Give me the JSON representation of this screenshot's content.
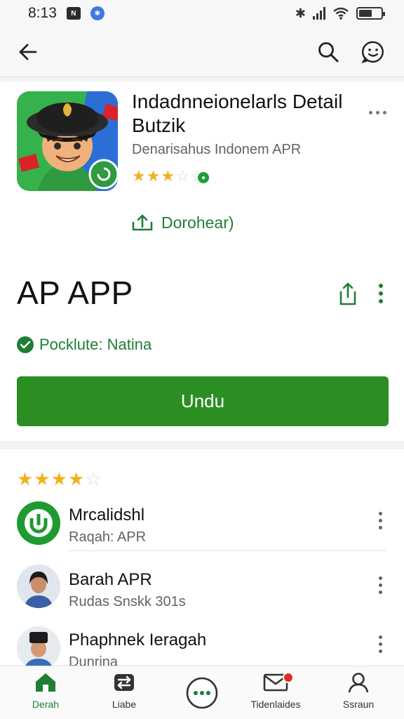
{
  "status_bar": {
    "time": "8:13",
    "badge_icon": "app-badge-icon",
    "notification_icon": "notification-dot-icon"
  },
  "top_bar": {
    "back_icon": "arrow-left-icon",
    "search_icon": "search-icon",
    "feedback_icon": "smiley-icon"
  },
  "app": {
    "title": "Indadnneionelarls Detail Butzik",
    "developer": "Denarisahus Indonem APR",
    "rating_stars": 3,
    "rating_max": 5,
    "download_label": "Dorohear)",
    "name": "AP APP",
    "verified_label": "Pocklute: Natina",
    "install_label": "Undu"
  },
  "list": {
    "rating_stars": 4,
    "rating_max": 5,
    "items": [
      {
        "title": "Mrcalidshl",
        "subtitle": "Raqah: APR"
      },
      {
        "title": "Barah APR",
        "subtitle": "Rudas Snskk 301s"
      },
      {
        "title": "Phaphnek Ieragah",
        "subtitle": "Dunrina"
      }
    ]
  },
  "bottom_nav": {
    "items": [
      {
        "label": "Derah",
        "icon": "home-icon",
        "active": true
      },
      {
        "label": "Liabe",
        "icon": "swap-icon",
        "active": false
      },
      {
        "label": "",
        "icon": "chat-bubble-icon",
        "active": false
      },
      {
        "label": "Tidenlaides",
        "icon": "mail-icon",
        "active": false
      },
      {
        "label": "Ssraun",
        "icon": "profile-icon",
        "active": false
      }
    ]
  },
  "colors": {
    "accent_green": "#2a8e22",
    "text_green": "#1e7e34",
    "star_gold": "#f2b01e",
    "notification_red": "#d93025"
  }
}
